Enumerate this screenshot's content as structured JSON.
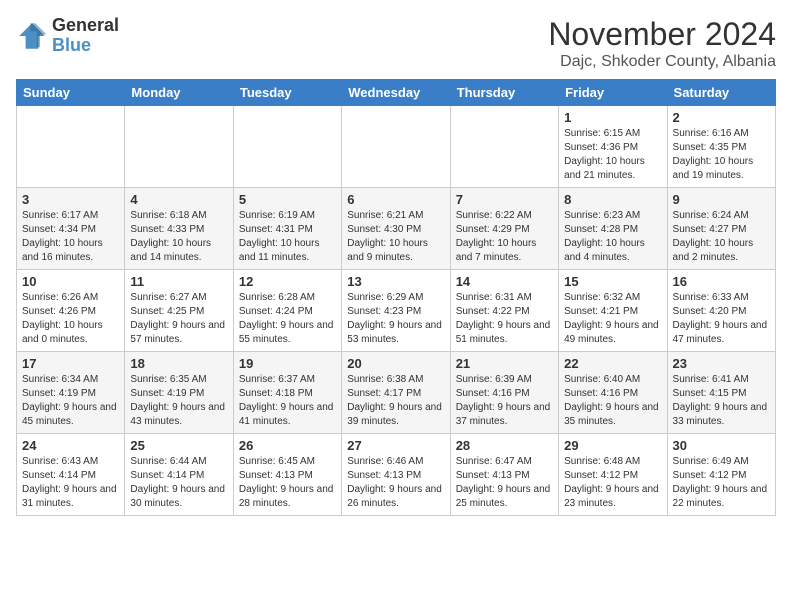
{
  "header": {
    "logo_general": "General",
    "logo_blue": "Blue",
    "month_title": "November 2024",
    "location": "Dajc, Shkoder County, Albania"
  },
  "weekdays": [
    "Sunday",
    "Monday",
    "Tuesday",
    "Wednesday",
    "Thursday",
    "Friday",
    "Saturday"
  ],
  "weeks": [
    [
      {
        "day": "",
        "info": ""
      },
      {
        "day": "",
        "info": ""
      },
      {
        "day": "",
        "info": ""
      },
      {
        "day": "",
        "info": ""
      },
      {
        "day": "",
        "info": ""
      },
      {
        "day": "1",
        "info": "Sunrise: 6:15 AM\nSunset: 4:36 PM\nDaylight: 10 hours and 21 minutes."
      },
      {
        "day": "2",
        "info": "Sunrise: 6:16 AM\nSunset: 4:35 PM\nDaylight: 10 hours and 19 minutes."
      }
    ],
    [
      {
        "day": "3",
        "info": "Sunrise: 6:17 AM\nSunset: 4:34 PM\nDaylight: 10 hours and 16 minutes."
      },
      {
        "day": "4",
        "info": "Sunrise: 6:18 AM\nSunset: 4:33 PM\nDaylight: 10 hours and 14 minutes."
      },
      {
        "day": "5",
        "info": "Sunrise: 6:19 AM\nSunset: 4:31 PM\nDaylight: 10 hours and 11 minutes."
      },
      {
        "day": "6",
        "info": "Sunrise: 6:21 AM\nSunset: 4:30 PM\nDaylight: 10 hours and 9 minutes."
      },
      {
        "day": "7",
        "info": "Sunrise: 6:22 AM\nSunset: 4:29 PM\nDaylight: 10 hours and 7 minutes."
      },
      {
        "day": "8",
        "info": "Sunrise: 6:23 AM\nSunset: 4:28 PM\nDaylight: 10 hours and 4 minutes."
      },
      {
        "day": "9",
        "info": "Sunrise: 6:24 AM\nSunset: 4:27 PM\nDaylight: 10 hours and 2 minutes."
      }
    ],
    [
      {
        "day": "10",
        "info": "Sunrise: 6:26 AM\nSunset: 4:26 PM\nDaylight: 10 hours and 0 minutes."
      },
      {
        "day": "11",
        "info": "Sunrise: 6:27 AM\nSunset: 4:25 PM\nDaylight: 9 hours and 57 minutes."
      },
      {
        "day": "12",
        "info": "Sunrise: 6:28 AM\nSunset: 4:24 PM\nDaylight: 9 hours and 55 minutes."
      },
      {
        "day": "13",
        "info": "Sunrise: 6:29 AM\nSunset: 4:23 PM\nDaylight: 9 hours and 53 minutes."
      },
      {
        "day": "14",
        "info": "Sunrise: 6:31 AM\nSunset: 4:22 PM\nDaylight: 9 hours and 51 minutes."
      },
      {
        "day": "15",
        "info": "Sunrise: 6:32 AM\nSunset: 4:21 PM\nDaylight: 9 hours and 49 minutes."
      },
      {
        "day": "16",
        "info": "Sunrise: 6:33 AM\nSunset: 4:20 PM\nDaylight: 9 hours and 47 minutes."
      }
    ],
    [
      {
        "day": "17",
        "info": "Sunrise: 6:34 AM\nSunset: 4:19 PM\nDaylight: 9 hours and 45 minutes."
      },
      {
        "day": "18",
        "info": "Sunrise: 6:35 AM\nSunset: 4:19 PM\nDaylight: 9 hours and 43 minutes."
      },
      {
        "day": "19",
        "info": "Sunrise: 6:37 AM\nSunset: 4:18 PM\nDaylight: 9 hours and 41 minutes."
      },
      {
        "day": "20",
        "info": "Sunrise: 6:38 AM\nSunset: 4:17 PM\nDaylight: 9 hours and 39 minutes."
      },
      {
        "day": "21",
        "info": "Sunrise: 6:39 AM\nSunset: 4:16 PM\nDaylight: 9 hours and 37 minutes."
      },
      {
        "day": "22",
        "info": "Sunrise: 6:40 AM\nSunset: 4:16 PM\nDaylight: 9 hours and 35 minutes."
      },
      {
        "day": "23",
        "info": "Sunrise: 6:41 AM\nSunset: 4:15 PM\nDaylight: 9 hours and 33 minutes."
      }
    ],
    [
      {
        "day": "24",
        "info": "Sunrise: 6:43 AM\nSunset: 4:14 PM\nDaylight: 9 hours and 31 minutes."
      },
      {
        "day": "25",
        "info": "Sunrise: 6:44 AM\nSunset: 4:14 PM\nDaylight: 9 hours and 30 minutes."
      },
      {
        "day": "26",
        "info": "Sunrise: 6:45 AM\nSunset: 4:13 PM\nDaylight: 9 hours and 28 minutes."
      },
      {
        "day": "27",
        "info": "Sunrise: 6:46 AM\nSunset: 4:13 PM\nDaylight: 9 hours and 26 minutes."
      },
      {
        "day": "28",
        "info": "Sunrise: 6:47 AM\nSunset: 4:13 PM\nDaylight: 9 hours and 25 minutes."
      },
      {
        "day": "29",
        "info": "Sunrise: 6:48 AM\nSunset: 4:12 PM\nDaylight: 9 hours and 23 minutes."
      },
      {
        "day": "30",
        "info": "Sunrise: 6:49 AM\nSunset: 4:12 PM\nDaylight: 9 hours and 22 minutes."
      }
    ]
  ]
}
